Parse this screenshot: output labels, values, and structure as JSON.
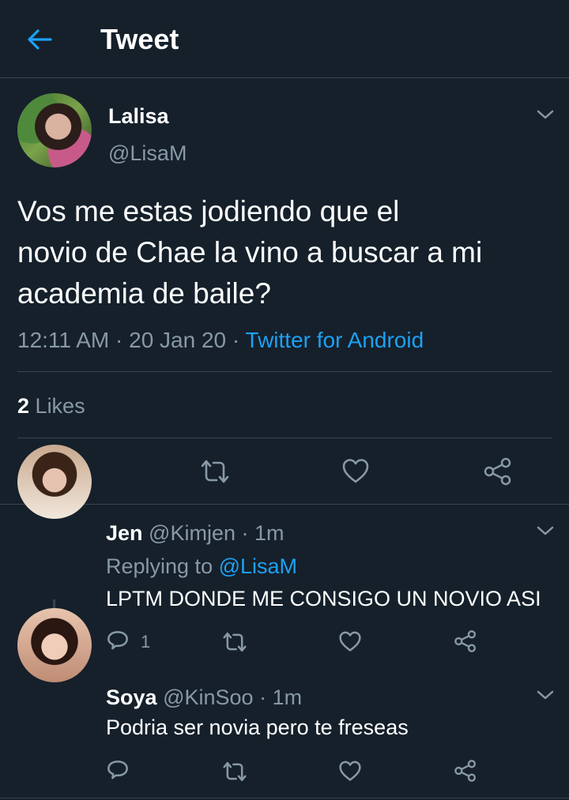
{
  "header": {
    "title": "Tweet",
    "back_icon": "arrow-left-icon",
    "accent": "#1da1f2"
  },
  "main_tweet": {
    "name": "Lalisa",
    "handle": "@LisaM",
    "text_lines": [
      "Vos me estas jodiendo que el",
      "novio de Chae la vino a buscar a mi",
      "academia de baile?"
    ],
    "time": "12:11 AM",
    "date": "20 Jan 20",
    "separator": " · ",
    "source": "Twitter for Android",
    "likes_count": "2",
    "likes_label": "Likes",
    "actions": [
      "reply-icon",
      "retweet-icon",
      "like-icon",
      "share-icon"
    ]
  },
  "replies": [
    {
      "name": "Jen",
      "handle": "@Kimjen",
      "time": "1m",
      "replying_label": "Replying to",
      "replying_handle": "@LisaM",
      "text": "LPTM DONDE ME CONSIGO UN NOVIO ASI",
      "reply_count": "1"
    },
    {
      "name": "Soya",
      "handle": "@KinSoo",
      "time": "1m",
      "text": "Podria ser novia pero te freseas"
    }
  ],
  "colors": {
    "background": "#15202b",
    "secondary_text": "#8899a6",
    "divider": "#38444d"
  }
}
